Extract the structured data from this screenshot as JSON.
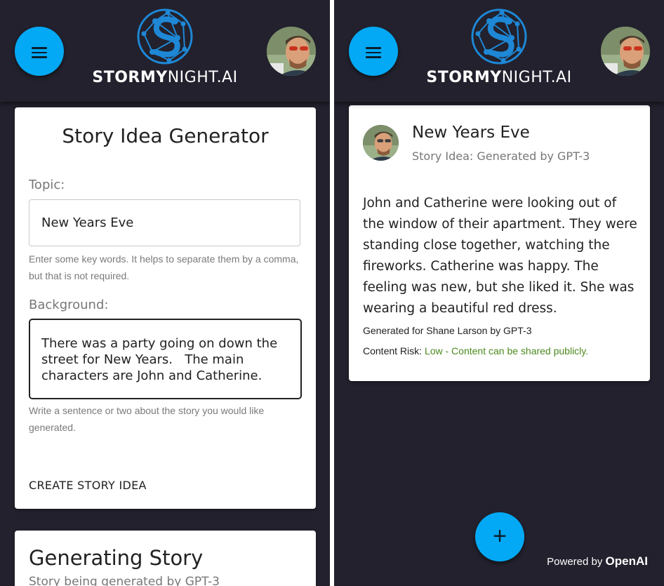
{
  "header": {
    "logo_text_bold": "STORMY",
    "logo_text_light": "NIGHT.AI",
    "menu_icon": "menu-icon",
    "avatar_icon": "user-avatar"
  },
  "generator": {
    "title": "Story Idea Generator",
    "topic_label": "Topic:",
    "topic_value": "New Years Eve",
    "topic_hint": "Enter some key words. It helps to separate them by a comma, but that is not required.",
    "background_label": "Background:",
    "background_value": "There was a party going on down the street for New Years.   The main characters are John and Catherine.",
    "background_hint": "Write a sentence or two about the story you would like generated.",
    "create_button": "CREATE STORY IDEA"
  },
  "generating": {
    "title": "Generating Story",
    "subtitle": "Story being generated by GPT-3"
  },
  "story": {
    "title": "New Years Eve",
    "subtitle": "Story Idea: Generated by GPT-3",
    "body": "John and Catherine were looking out of the window of their apartment. They were standing close together, watching the fireworks. Catherine was happy. The feeling was new, but she liked it. She was wearing a beautiful red dress.",
    "generated_for": "Generated for Shane Larson by GPT-3",
    "risk_label": "Content Risk:",
    "risk_value": "Low - Content can be shared publicly."
  },
  "footer": {
    "add_icon": "+",
    "powered_by": "Powered by",
    "powered_brand": "OpenAI"
  },
  "colors": {
    "background": "#22212d",
    "accent": "#03a9f4",
    "risk_low": "#4c8a1e"
  }
}
